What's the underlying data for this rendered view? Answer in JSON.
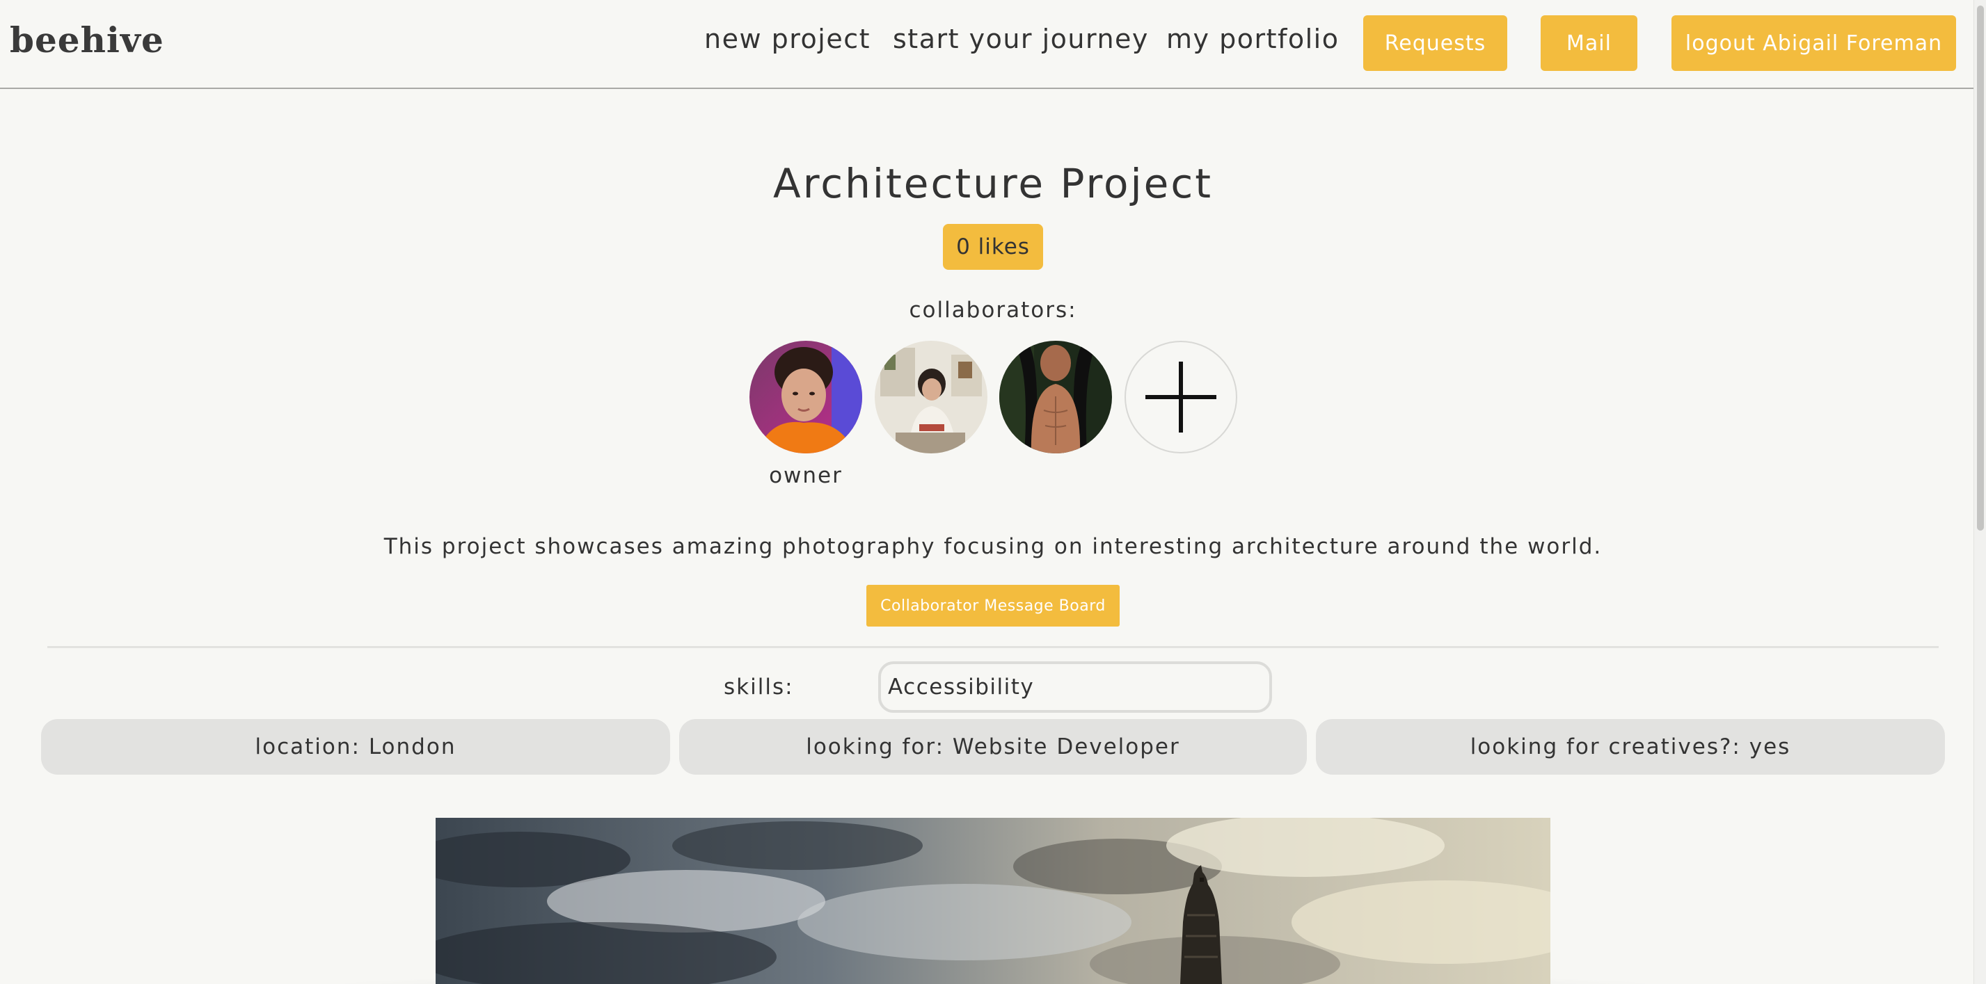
{
  "nav": {
    "logo": "beehive",
    "links": [
      "new project",
      "start your journey",
      "my portfolio"
    ],
    "requests_label": "Requests",
    "mail_label": "Mail",
    "logout_label": "logout Abigail Foreman"
  },
  "project": {
    "title": "Architecture Project",
    "likes_label": "0 likes",
    "collaborators_label": "collaborators:",
    "owner_label": "owner",
    "description": "This project showcases amazing photography focusing on interesting architecture around the world.",
    "message_board_label": "Collaborator Message Board",
    "skills_label": "skills:",
    "skills_value": "Accessibility",
    "location": "location: London",
    "looking_for": "looking for: Website Developer",
    "looking_for_creatives": "looking for creatives?: yes"
  },
  "colors": {
    "accent": "#f3bc3e",
    "background": "#f7f7f4",
    "pill": "#e2e2e0",
    "text": "#333333"
  },
  "icons": [
    "plus-icon"
  ]
}
